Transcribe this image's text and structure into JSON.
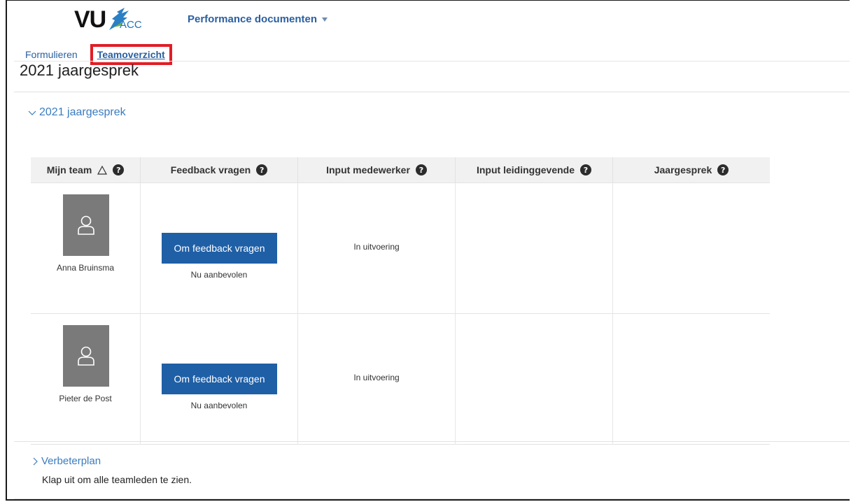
{
  "brand": {
    "logo_text": "VU",
    "logo_suffix": "ACC"
  },
  "header": {
    "app_title": "Performance documenten"
  },
  "nav": {
    "tabs": [
      {
        "label": "Formulieren"
      },
      {
        "label": "Teamoverzicht",
        "active": true
      }
    ]
  },
  "page": {
    "title": "2021 jaargesprek"
  },
  "section": {
    "title": "2021 jaargesprek",
    "expanded": true
  },
  "table": {
    "columns": [
      {
        "label": "Mijn team",
        "sort_icon": "sort-triangle-icon",
        "help_icon": "help-icon"
      },
      {
        "label": "Feedback vragen",
        "help_icon": "help-icon"
      },
      {
        "label": "Input medewerker",
        "help_icon": "help-icon"
      },
      {
        "label": "Input leidinggevende",
        "help_icon": "help-icon"
      },
      {
        "label": "Jaargesprek",
        "help_icon": "help-icon"
      }
    ],
    "rows": [
      {
        "name": "Anna Bruinsma",
        "feedback_button": "Om feedback vragen",
        "feedback_note": "Nu aanbevolen",
        "input_medewerker": "In uitvoering",
        "input_leidinggevende": "",
        "jaargesprek": ""
      },
      {
        "name": "Pieter de Post",
        "feedback_button": "Om feedback vragen",
        "feedback_note": "Nu aanbevolen",
        "input_medewerker": "In uitvoering",
        "input_leidinggevende": "",
        "jaargesprek": ""
      }
    ]
  },
  "section2": {
    "title": "Verbeterplan",
    "expanded": false,
    "hint": "Klap uit om alle teamleden te zien."
  },
  "colors": {
    "primary_button": "#1f5fa6",
    "link": "#3a7cc0",
    "header_bg": "#f1f1f1",
    "highlight": "#e11d26",
    "avatar_bg": "#7a7a7a"
  }
}
